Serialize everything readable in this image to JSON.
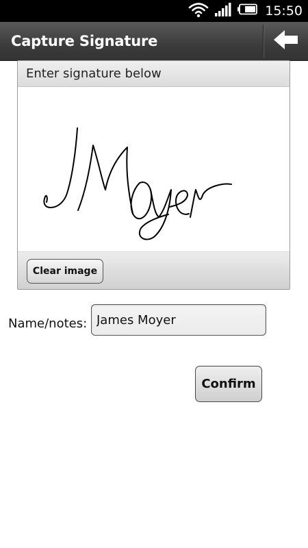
{
  "status_bar": {
    "time": "15:50",
    "icons": [
      "wifi-icon",
      "signal-icon",
      "battery-icon"
    ]
  },
  "app": {
    "title": "Capture Signature",
    "back_icon": "back-arrow-icon"
  },
  "signature_panel": {
    "header": "Enter signature below",
    "signature_text": "JMoyer",
    "clear_label": "Clear image"
  },
  "form": {
    "name_label": "Name/notes:",
    "name_value": "James Moyer",
    "confirm_label": "Confirm"
  }
}
